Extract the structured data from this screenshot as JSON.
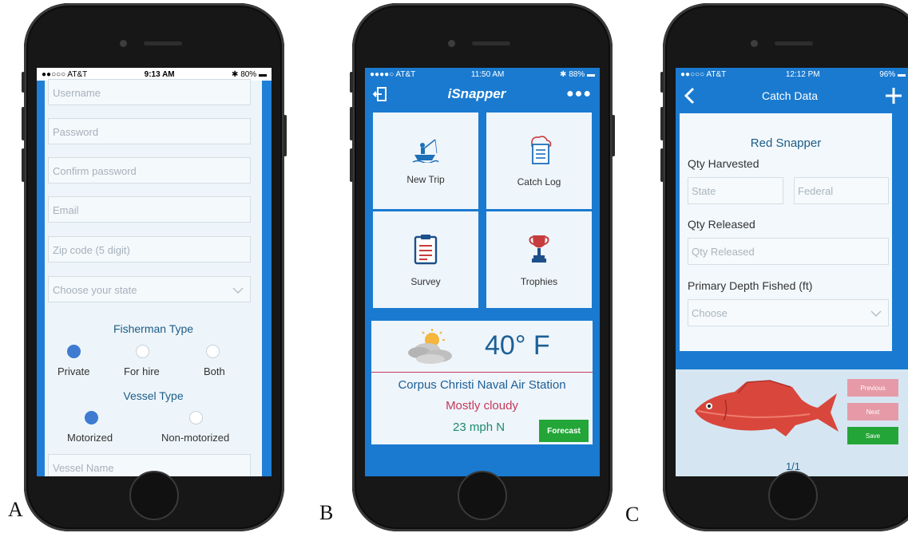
{
  "labels": {
    "a": "A",
    "b": "B",
    "c": "C"
  },
  "screenA": {
    "status": {
      "carrier": "●●○○○ AT&T",
      "time": "9:13 AM",
      "battery": "80%"
    },
    "fields": [
      "Username",
      "Password",
      "Confirm password",
      "Email",
      "Zip code (5 digit)"
    ],
    "state_placeholder": "Choose your state",
    "fisherman_type": {
      "title": "Fisherman Type",
      "options": [
        "Private",
        "For hire",
        "Both"
      ],
      "selected": "Private"
    },
    "vessel_type": {
      "title": "Vessel Type",
      "options": [
        "Motorized",
        "Non-motorized"
      ],
      "selected": "Motorized"
    },
    "vessel_name_placeholder": "Vessel Name"
  },
  "screenB": {
    "status": {
      "carrier": "●●●●○ AT&T",
      "time": "11:50 AM",
      "battery": "88%"
    },
    "title": "iSnapper",
    "tiles": [
      "New Trip",
      "Catch Log",
      "Survey",
      "Trophies"
    ],
    "weather": {
      "temp": "40° F",
      "station": "Corpus Christi Naval Air Station",
      "condition": "Mostly cloudy",
      "wind": "23 mph N",
      "forecast_button": "Forecast"
    },
    "colors": {
      "condition": "#c7385a",
      "forecast": "#23a637",
      "accent": "#1a7ad0"
    }
  },
  "screenC": {
    "status": {
      "carrier": "●●○○○ AT&T",
      "time": "12:12 PM",
      "battery": "96%"
    },
    "title": "Catch Data",
    "species": "Red Snapper",
    "qty_harvested_label": "Qty Harvested",
    "state_placeholder": "State",
    "federal_placeholder": "Federal",
    "qty_released_label": "Qty Released",
    "qty_released_placeholder": "Qty Released",
    "depth_label": "Primary Depth Fished (ft)",
    "depth_placeholder": "Choose",
    "buttons": {
      "previous": "Previous",
      "next": "Next",
      "save": "Save"
    },
    "pager": "1/1"
  }
}
